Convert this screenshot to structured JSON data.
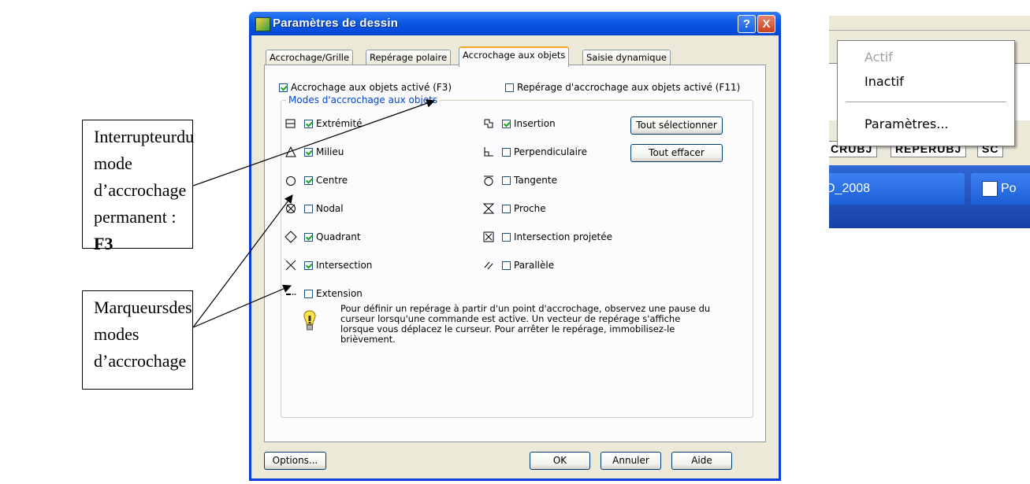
{
  "callouts": {
    "switch": {
      "line1a": "Interrupteur",
      "line1b": "du",
      "line2": "mode",
      "line3": "d’accrochage",
      "line4": "permanent :",
      "key": "F3"
    },
    "markers": {
      "line1a": "Marqueurs",
      "line1b": "des",
      "line2": "modes",
      "line3": "d’accrochage"
    }
  },
  "dialog": {
    "title": "Paramètres de dessin",
    "help_symbol": "?",
    "close_symbol": "X",
    "tabs": [
      "Accrochage/Grille",
      "Repérage polaire",
      "Accrochage aux objets",
      "Saisie dynamique"
    ],
    "active_tab": 2,
    "snap_enabled": {
      "label": "Accrochage aux objets activé (F3)",
      "checked": true
    },
    "tracking_enabled": {
      "label": "Repérage d'accrochage aux objets activé (F11)",
      "checked": false
    },
    "group_title": "Modes d'accrochage aux objets",
    "modes_left": [
      {
        "label": "Extrémité",
        "checked": true,
        "icon": "square-marker-icon"
      },
      {
        "label": "Milieu",
        "checked": true,
        "icon": "triangle-marker-icon"
      },
      {
        "label": "Centre",
        "checked": true,
        "icon": "circle-marker-icon"
      },
      {
        "label": "Nodal",
        "checked": false,
        "icon": "node-marker-icon"
      },
      {
        "label": "Quadrant",
        "checked": true,
        "icon": "diamond-marker-icon"
      },
      {
        "label": "Intersection",
        "checked": true,
        "icon": "cross-marker-icon"
      },
      {
        "label": "Extension",
        "checked": false,
        "icon": "extension-marker-icon"
      }
    ],
    "modes_right": [
      {
        "label": "Insertion",
        "checked": true,
        "icon": "insertion-marker-icon"
      },
      {
        "label": "Perpendiculaire",
        "checked": false,
        "icon": "perpendicular-marker-icon"
      },
      {
        "label": "Tangente",
        "checked": false,
        "icon": "tangent-marker-icon"
      },
      {
        "label": "Proche",
        "checked": false,
        "icon": "nearest-marker-icon"
      },
      {
        "label": "Intersection projetée",
        "checked": false,
        "icon": "apparent-intersection-marker-icon"
      },
      {
        "label": "Parallèle",
        "checked": false,
        "icon": "parallel-marker-icon"
      }
    ],
    "select_all": "Tout sélectionner",
    "clear_all": "Tout effacer",
    "hint": "Pour définir un repérage à partir d'un point d'accrochage, observez une pause du curseur lorsqu'une commande est active. Un vecteur de repérage s'affiche lorsque vous déplacez le curseur. Pour arrêter le repérage, immobilisez-le brièvement.",
    "options": "Options...",
    "ok": "OK",
    "cancel": "Annuler",
    "help": "Aide"
  },
  "snippet": {
    "menu": [
      "Actif",
      "Inactif",
      "Paramètres..."
    ],
    "status_tabs": [
      "CRUBJ",
      "REPERUBJ",
      "SC"
    ],
    "taskbar": [
      "D_2008",
      "Po"
    ]
  },
  "colors": {
    "title_blue": "#0346d6",
    "xp_face": "#ece9d8",
    "check_green": "#21a121",
    "close_red": "#c9401f",
    "active_tab_orange": "#f5a623"
  }
}
